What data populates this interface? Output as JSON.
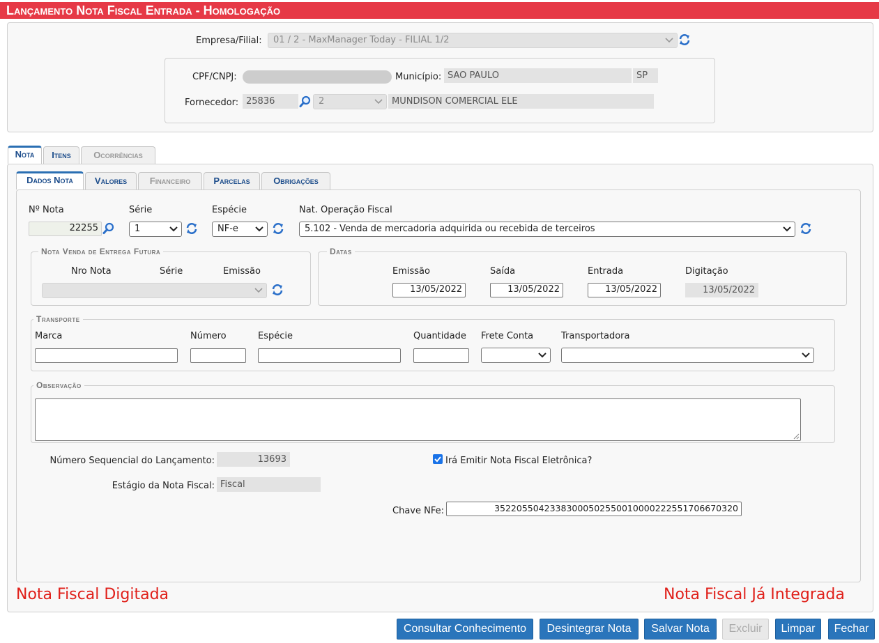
{
  "header": {
    "title": "Lançamento Nota Fiscal Entrada   - Homologação"
  },
  "top": {
    "empresa_label": "Empresa/Filial:",
    "empresa_value": "01 / 2 - MaxManager Today - FILIAL 1/2",
    "cpf_label": "CPF/CNPJ:",
    "municipio_label": "Município:",
    "municipio_value": "SAO PAULO",
    "uf_value": "SP",
    "fornecedor_label": "Fornecedor:",
    "fornecedor_code": "25836",
    "fornecedor_seq": "2",
    "fornecedor_name": "MUNDISON COMERCIAL ELE"
  },
  "tabs": [
    "Nota",
    "Itens",
    "Ocorrências"
  ],
  "subtabs": [
    "Dados Nota",
    "Valores",
    "Financeiro",
    "Parcelas",
    "Obrigações"
  ],
  "nota": {
    "numero_label": "Nº Nota",
    "numero_value": "22255",
    "serie_label": "Série",
    "serie_value": "1",
    "especie_label": "Espécie",
    "especie_value": "NF-e",
    "natop_label": "Nat. Operação Fiscal",
    "natop_value": "5.102 - Venda de mercadoria adquirida ou recebida de terceiros"
  },
  "entrega_futura": {
    "legend": "Nota Venda de Entrega Futura",
    "nro_label": "Nro Nota",
    "serie_label": "Série",
    "emissao_label": "Emissão"
  },
  "datas": {
    "legend": "Datas",
    "emissao_label": "Emissão",
    "emissao_value": "13/05/2022",
    "saida_label": "Saída",
    "saida_value": "13/05/2022",
    "entrada_label": "Entrada",
    "entrada_value": "13/05/2022",
    "digitacao_label": "Digitação",
    "digitacao_value": "13/05/2022"
  },
  "transporte": {
    "legend": "Transporte",
    "marca_label": "Marca",
    "numero_label": "Número",
    "especie_label": "Espécie",
    "quantidade_label": "Quantidade",
    "frete_label": "Frete Conta",
    "transportadora_label": "Transportadora"
  },
  "observacao": {
    "legend": "Observação"
  },
  "footer_fields": {
    "sequencial_label": "Número Sequencial do Lançamento:",
    "sequencial_value": "13693",
    "estagio_label": "Estágio da Nota Fiscal:",
    "estagio_value": "Fiscal",
    "emitir_label": "Irá Emitir Nota Fiscal Eletrônica?",
    "emitir_checked": true,
    "chave_label": "Chave NFe:",
    "chave_value": "35220550423383000502550010000222551706670320"
  },
  "status": {
    "left": "Nota Fiscal Digitada",
    "right": "Nota Fiscal Já Integrada"
  },
  "buttons": {
    "consultar": "Consultar Conhecimento",
    "desintegrar": "Desintegrar Nota",
    "salvar": "Salvar Nota",
    "excluir": "Excluir",
    "limpar": "Limpar",
    "fechar": "Fechar"
  },
  "colors": {
    "title_bar": "#e63946",
    "accent": "#2a75bb",
    "status_text": "#e0201a"
  }
}
